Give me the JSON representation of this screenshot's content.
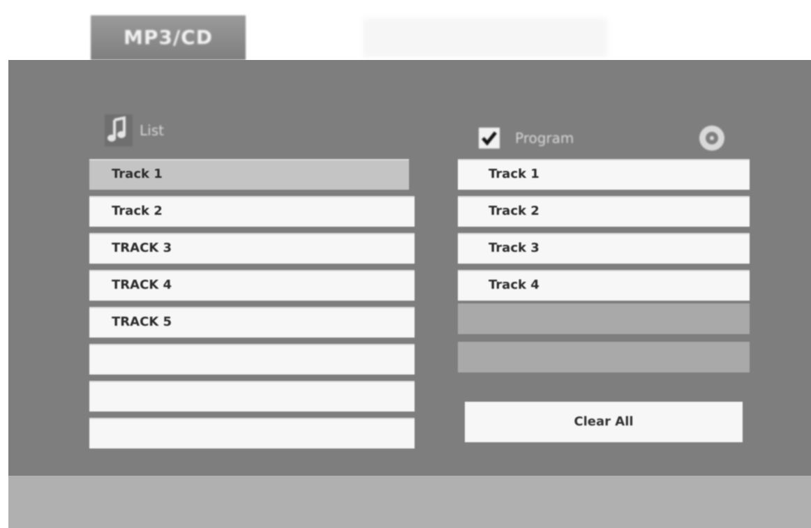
{
  "tab": {
    "label": "MP3/CD"
  },
  "list": {
    "header_label": "List",
    "tracks": [
      {
        "label": "Track 1"
      },
      {
        "label": "Track 2"
      },
      {
        "label": "TRACK 3"
      },
      {
        "label": "TRACK 4"
      },
      {
        "label": "TRACK 5"
      },
      {
        "label": ""
      },
      {
        "label": ""
      },
      {
        "label": ""
      }
    ]
  },
  "program": {
    "header_label": "Program",
    "checked": true,
    "items": [
      {
        "label": "Track 1"
      },
      {
        "label": "Track 2"
      },
      {
        "label": "Track 3"
      },
      {
        "label": "Track 4"
      },
      {
        "label": ""
      },
      {
        "label": ""
      }
    ],
    "clear_label": "Clear All"
  },
  "icons": {
    "music": "music-note-icon",
    "checkbox": "checkbox-checked-icon",
    "disc": "disc-icon"
  },
  "colors": {
    "panel": "#7e7e7e",
    "row": "#f7f7f7",
    "selected_row": "#c4c4c4",
    "empty_program_row": "#a9a9a9",
    "status_bar": "#b0b0b0"
  }
}
